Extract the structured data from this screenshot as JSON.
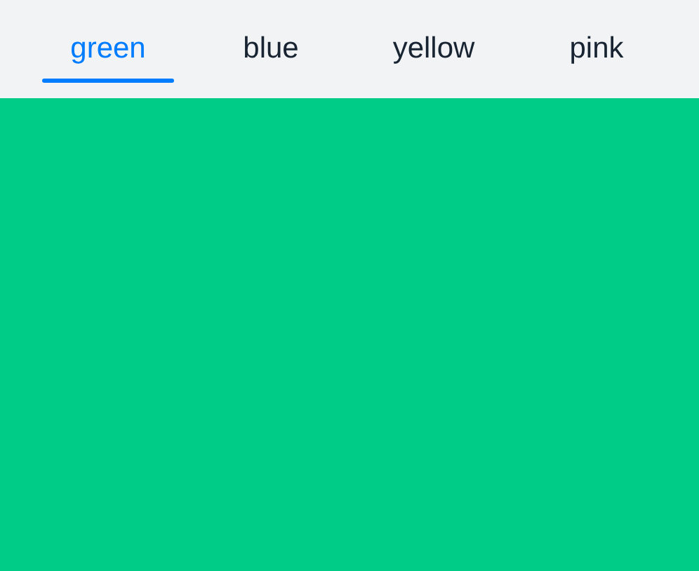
{
  "tabs": [
    {
      "label": "green",
      "selected": true
    },
    {
      "label": "blue",
      "selected": false
    },
    {
      "label": "yellow",
      "selected": false
    },
    {
      "label": "pink",
      "selected": false
    }
  ]
}
